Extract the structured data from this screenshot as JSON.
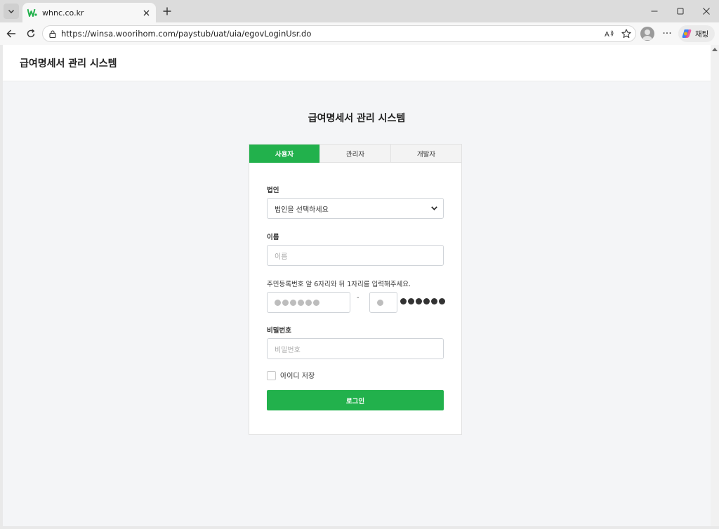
{
  "browser": {
    "tab": {
      "title": "whnc.co.kr"
    },
    "url": "https://winsa.woorihom.com/paystub/uat/uia/egovLoginUsr.do",
    "copilot_label": "채팅",
    "more_label": "···"
  },
  "site": {
    "header_title": "급여명세서 관리 시스템"
  },
  "login": {
    "heading": "급여명세서 관리 시스템",
    "tabs": [
      {
        "label": "사용자",
        "active": true
      },
      {
        "label": "관리자",
        "active": false
      },
      {
        "label": "개발자",
        "active": false
      }
    ],
    "company": {
      "label": "법인",
      "value": "법인을 선택하세요"
    },
    "name": {
      "label": "이름",
      "placeholder": "이름"
    },
    "rrn": {
      "label": "주민등록번호 앞 6자리와 뒤 1자리를 입력해주세요.",
      "separator": "-",
      "front_placeholder": "●●●●●●",
      "back_placeholder": "●",
      "mask": "●●●●●●"
    },
    "password": {
      "label": "비밀번호",
      "placeholder": "비밀번호"
    },
    "remember": {
      "label": "아이디 저장",
      "checked": false
    },
    "submit_label": "로그인"
  },
  "colors": {
    "accent": "#22b14c",
    "page_bg": "#f4f5f7"
  }
}
